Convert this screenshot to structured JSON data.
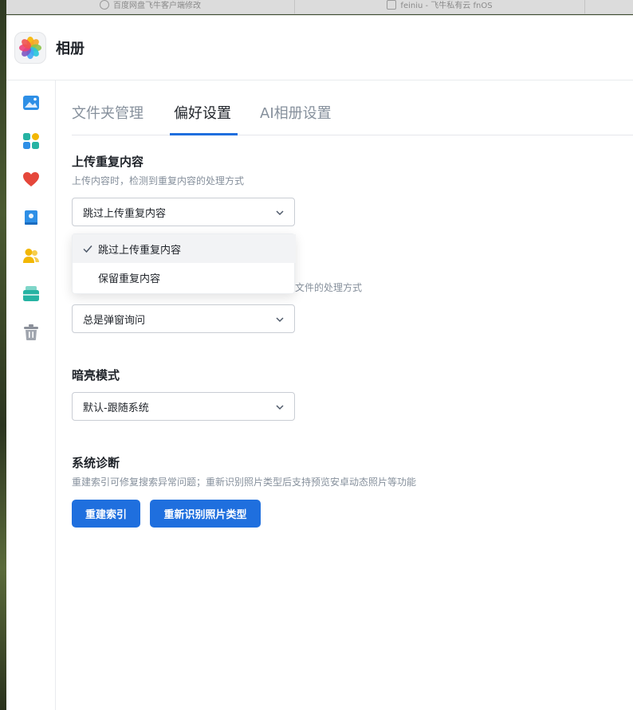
{
  "browser_tabs": [
    {
      "label": "百度网盘飞牛客户端修改",
      "icon": "globe-icon"
    },
    {
      "label": "feiniu - 飞牛私有云 fnOS",
      "icon": "page-icon"
    }
  ],
  "app": {
    "title": "相册",
    "logo_icon": "photos-flower-icon"
  },
  "sidebar": {
    "items": [
      {
        "name": "photos",
        "icon": "image-icon",
        "color": "#2e8fe6"
      },
      {
        "name": "albums",
        "icon": "grid-icon",
        "color": "#26b3a3"
      },
      {
        "name": "favorites",
        "icon": "heart-icon",
        "color": "#e5473b"
      },
      {
        "name": "collections",
        "icon": "album-book-icon",
        "color": "#2e8fe6"
      },
      {
        "name": "people",
        "icon": "people-icon",
        "color": "#f2b705"
      },
      {
        "name": "folders",
        "icon": "folder-image-icon",
        "color": "#26b3a3"
      },
      {
        "name": "trash",
        "icon": "trash-icon",
        "color": "#8a8f99"
      }
    ]
  },
  "tabs": [
    {
      "label": "文件夹管理",
      "active": false
    },
    {
      "label": "偏好设置",
      "active": true
    },
    {
      "label": "AI相册设置",
      "active": false
    }
  ],
  "settings": {
    "upload_duplicate": {
      "title": "上传重复内容",
      "desc": "上传内容时，检测到重复内容的处理方式",
      "value": "跳过上传重复内容",
      "options": [
        "跳过上传重复内容",
        "保留重复内容"
      ]
    },
    "second": {
      "desc_visible_fragment": "文件的处理方式",
      "value": "总是弹窗询问"
    },
    "dark_mode": {
      "title": "暗亮模式",
      "value": "默认-跟随系统"
    },
    "diagnostics": {
      "title": "系统诊断",
      "desc": "重建索引可修复搜索异常问题；重新识别照片类型后支持预览安卓动态照片等功能",
      "rebuild_label": "重建索引",
      "reidentify_label": "重新识别照片类型"
    }
  },
  "colors": {
    "accent": "#1f6fde",
    "muted_text": "#86909c"
  }
}
